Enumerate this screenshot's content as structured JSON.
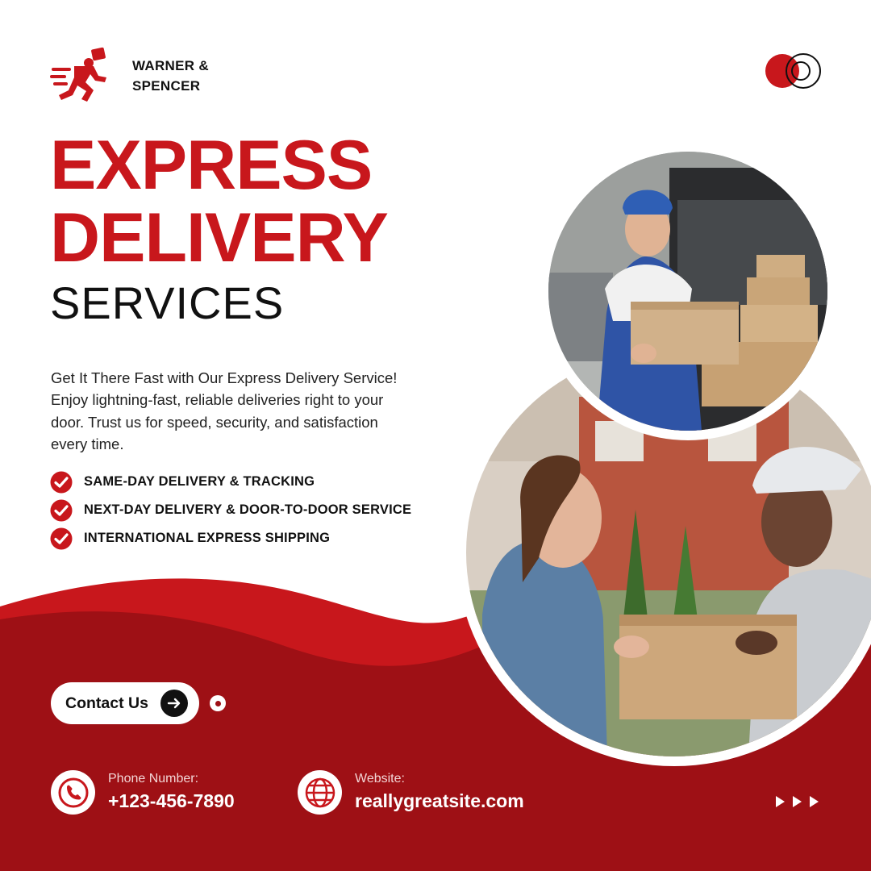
{
  "brand": {
    "name_line1": "WARNER &",
    "name_line2": "SPENCER",
    "logo_icon": "running-courier-icon"
  },
  "headline": {
    "line1": "EXPRESS",
    "line2": "DELIVERY",
    "line3": "SERVICES"
  },
  "description": "Get It There Fast with Our Express Delivery Service! Enjoy lightning-fast, reliable deliveries right to your door. Trust us for speed, security, and satisfaction every time.",
  "features": [
    "SAME-DAY DELIVERY & TRACKING",
    "NEXT-DAY DELIVERY & DOOR-TO-DOOR SERVICE",
    "INTERNATIONAL EXPRESS SHIPPING"
  ],
  "cta": {
    "label": "Contact Us",
    "icon": "arrow-right-icon"
  },
  "contact": {
    "phone_label": "Phone Number:",
    "phone_value": "+123-456-7890",
    "website_label": "Website:",
    "website_value": "reallygreatsite.com"
  },
  "colors": {
    "brand_red": "#c8171c",
    "dark_red": "#9e1015",
    "text_dark": "#111111"
  }
}
